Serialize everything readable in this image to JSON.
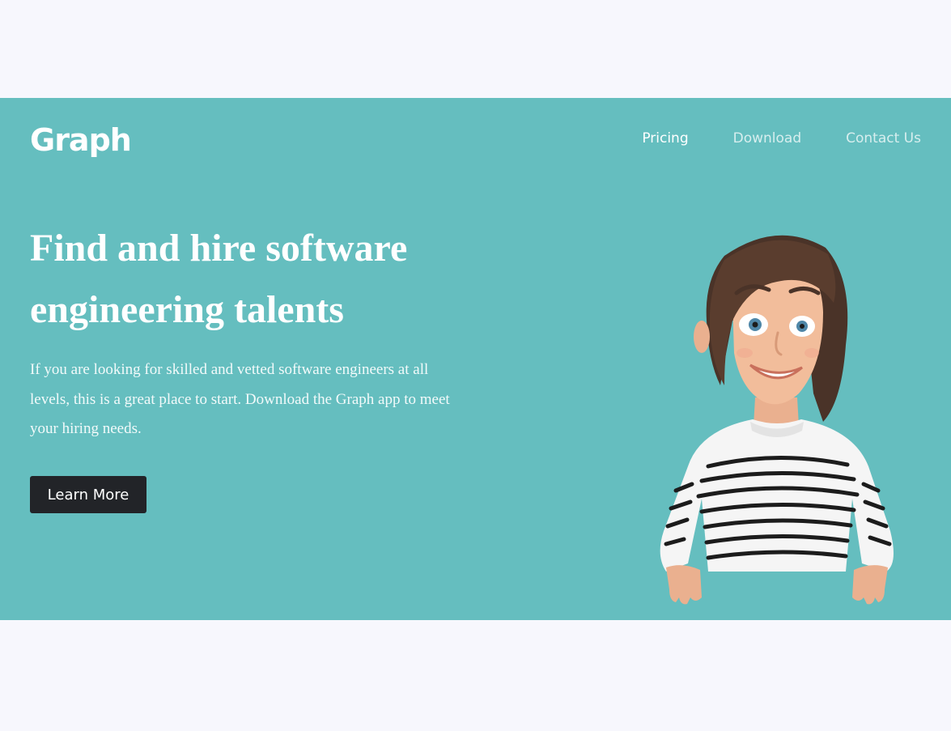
{
  "header": {
    "logo": "Graph",
    "nav": [
      {
        "label": "Pricing"
      },
      {
        "label": "Download"
      },
      {
        "label": "Contact Us"
      }
    ]
  },
  "hero": {
    "headline": "Find and hire software engineering talents",
    "description": "If you are looking for skilled and vetted software engineers at all levels, this is a great place to start. Download the Graph app to meet your hiring needs.",
    "cta_label": "Learn More",
    "illustration_icon": "cartoon-woman-illustration"
  },
  "colors": {
    "page_background": "#f7f7fd",
    "hero_background": "#65bebf",
    "button_background": "#222428",
    "text": "#ffffff"
  }
}
